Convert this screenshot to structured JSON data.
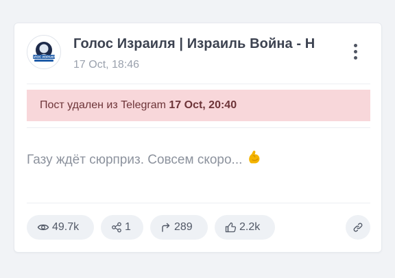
{
  "post": {
    "channel_title": "Голос Израиля | Израиль Война - Н",
    "date": "17 Oct, 18:46",
    "avatar_text": "ГОЛОС ИЗРАИЛЯ",
    "deleted_notice": "Пост удален из Telegram",
    "deleted_at": "17 Oct, 20:40",
    "text": "Газу ждёт сюрприз. Совсем скоро...",
    "emoji_icon": "flexed-biceps-emoji"
  },
  "stats": {
    "views": "49.7k",
    "reposts": "1",
    "forwards": "289",
    "reactions": "2.2k"
  },
  "colors": {
    "banner_bg": "#f8d7da",
    "banner_text": "#6d3438",
    "pill_bg": "#eef1f5",
    "avatar_blue": "#1e5ba8"
  }
}
